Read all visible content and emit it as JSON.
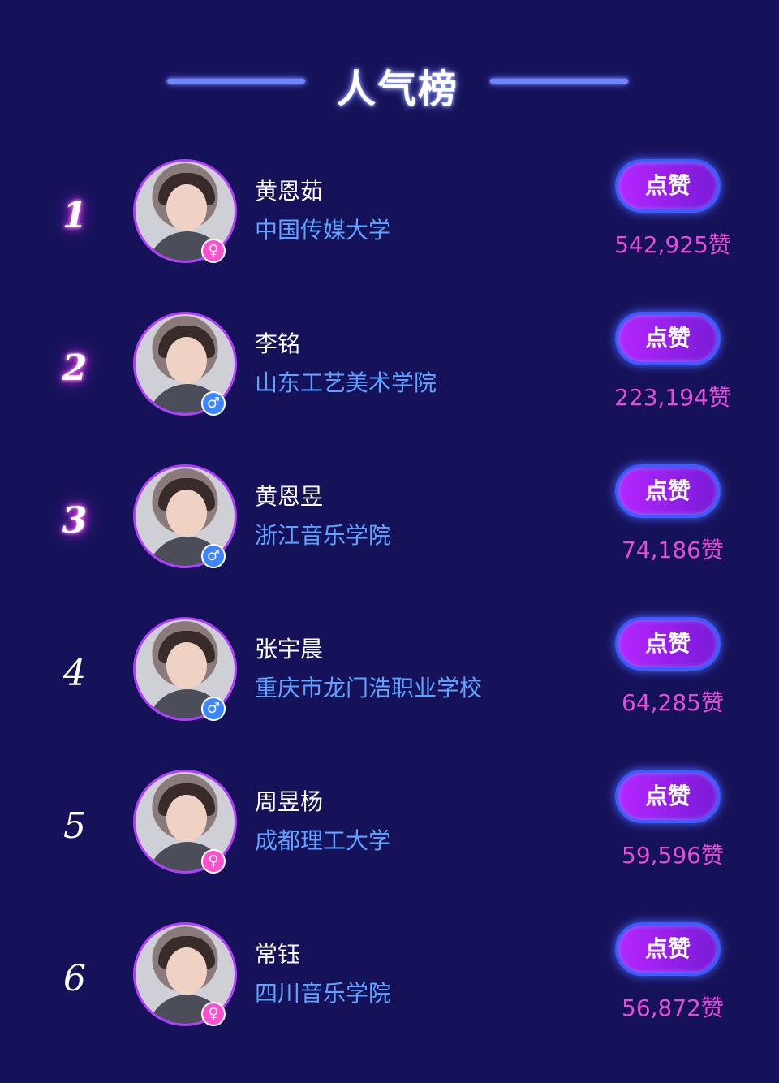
{
  "header": {
    "title": "人气榜"
  },
  "colors": {
    "background": "#16125a",
    "name": "#ffffff",
    "school": "#5fa2ff",
    "count": "#e54cd9",
    "button": "#b526ff"
  },
  "ranking": [
    {
      "rank": "1",
      "name": "黄恩茹",
      "school": "中国传媒大学",
      "gender_icon": "♀",
      "gender": "female",
      "button": "点赞",
      "likes": "542,925赞"
    },
    {
      "rank": "2",
      "name": "李铭",
      "school": "山东工艺美术学院",
      "gender_icon": "♂",
      "gender": "male",
      "button": "点赞",
      "likes": "223,194赞"
    },
    {
      "rank": "3",
      "name": "黄恩昱",
      "school": "浙江音乐学院",
      "gender_icon": "♂",
      "gender": "male",
      "button": "点赞",
      "likes": "74,186赞"
    },
    {
      "rank": "4",
      "name": "张宇晨",
      "school": "重庆市龙门浩职业学校",
      "gender_icon": "♂",
      "gender": "male",
      "button": "点赞",
      "likes": "64,285赞"
    },
    {
      "rank": "5",
      "name": "周昱杨",
      "school": "成都理工大学",
      "gender_icon": "♀",
      "gender": "female",
      "button": "点赞",
      "likes": "59,596赞"
    },
    {
      "rank": "6",
      "name": "常钰",
      "school": "四川音乐学院",
      "gender_icon": "♀",
      "gender": "female",
      "button": "点赞",
      "likes": "56,872赞"
    }
  ]
}
